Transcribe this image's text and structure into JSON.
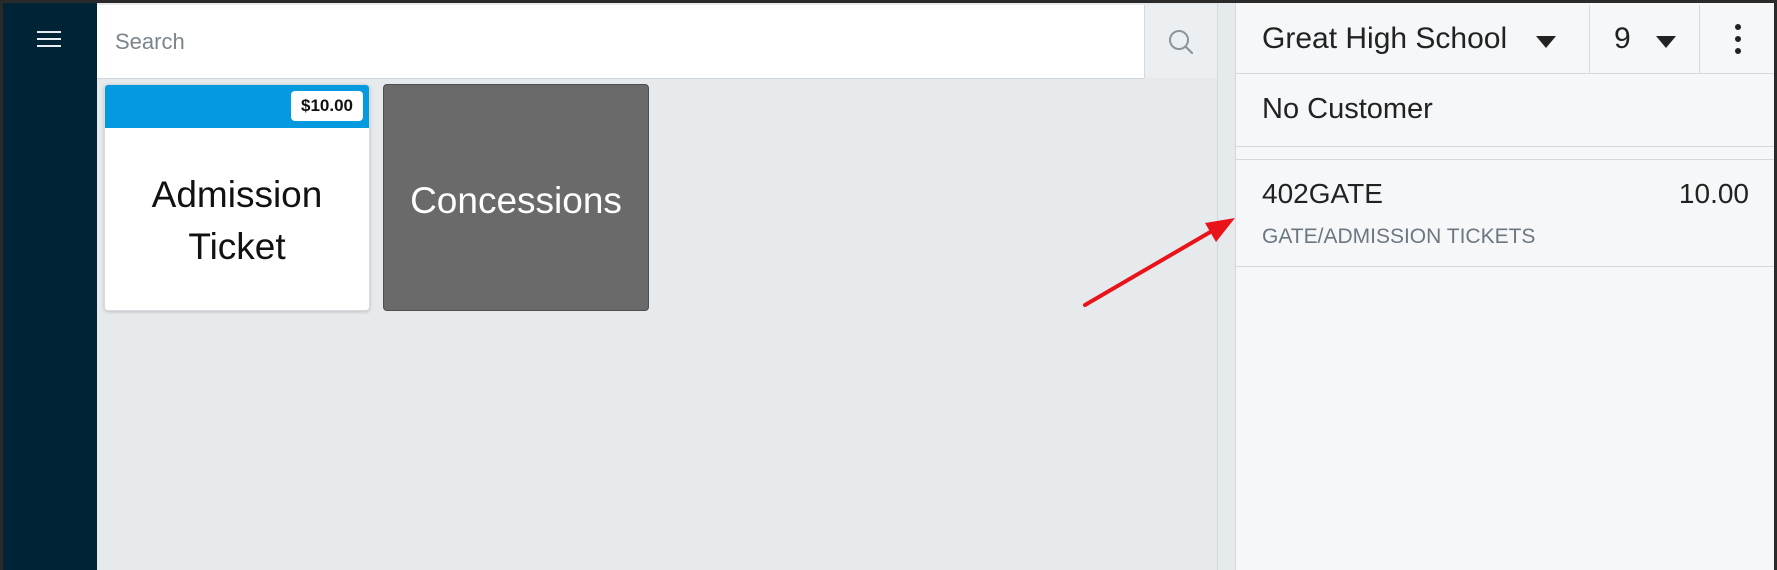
{
  "search": {
    "placeholder": "Search"
  },
  "products": [
    {
      "label_line1": "Admission",
      "label_line2": "Ticket",
      "price": "$10.00",
      "color": "#0599df"
    },
    {
      "label": "Concessions",
      "color": "#6a6a6a"
    }
  ],
  "panel": {
    "school": "Great High School",
    "register_number": "9",
    "customer": "No Customer",
    "order_lines": [
      {
        "code": "402GATE",
        "amount": "10.00",
        "category": "GATE/ADMISSION TICKETS"
      }
    ]
  },
  "colors": {
    "nav_background": "#012336",
    "accent": "#0599df",
    "annotation_arrow": "#e8141a"
  },
  "icons": [
    "hamburger-menu-icon",
    "search-icon",
    "caret-down-icon",
    "more-vertical-icon"
  ]
}
